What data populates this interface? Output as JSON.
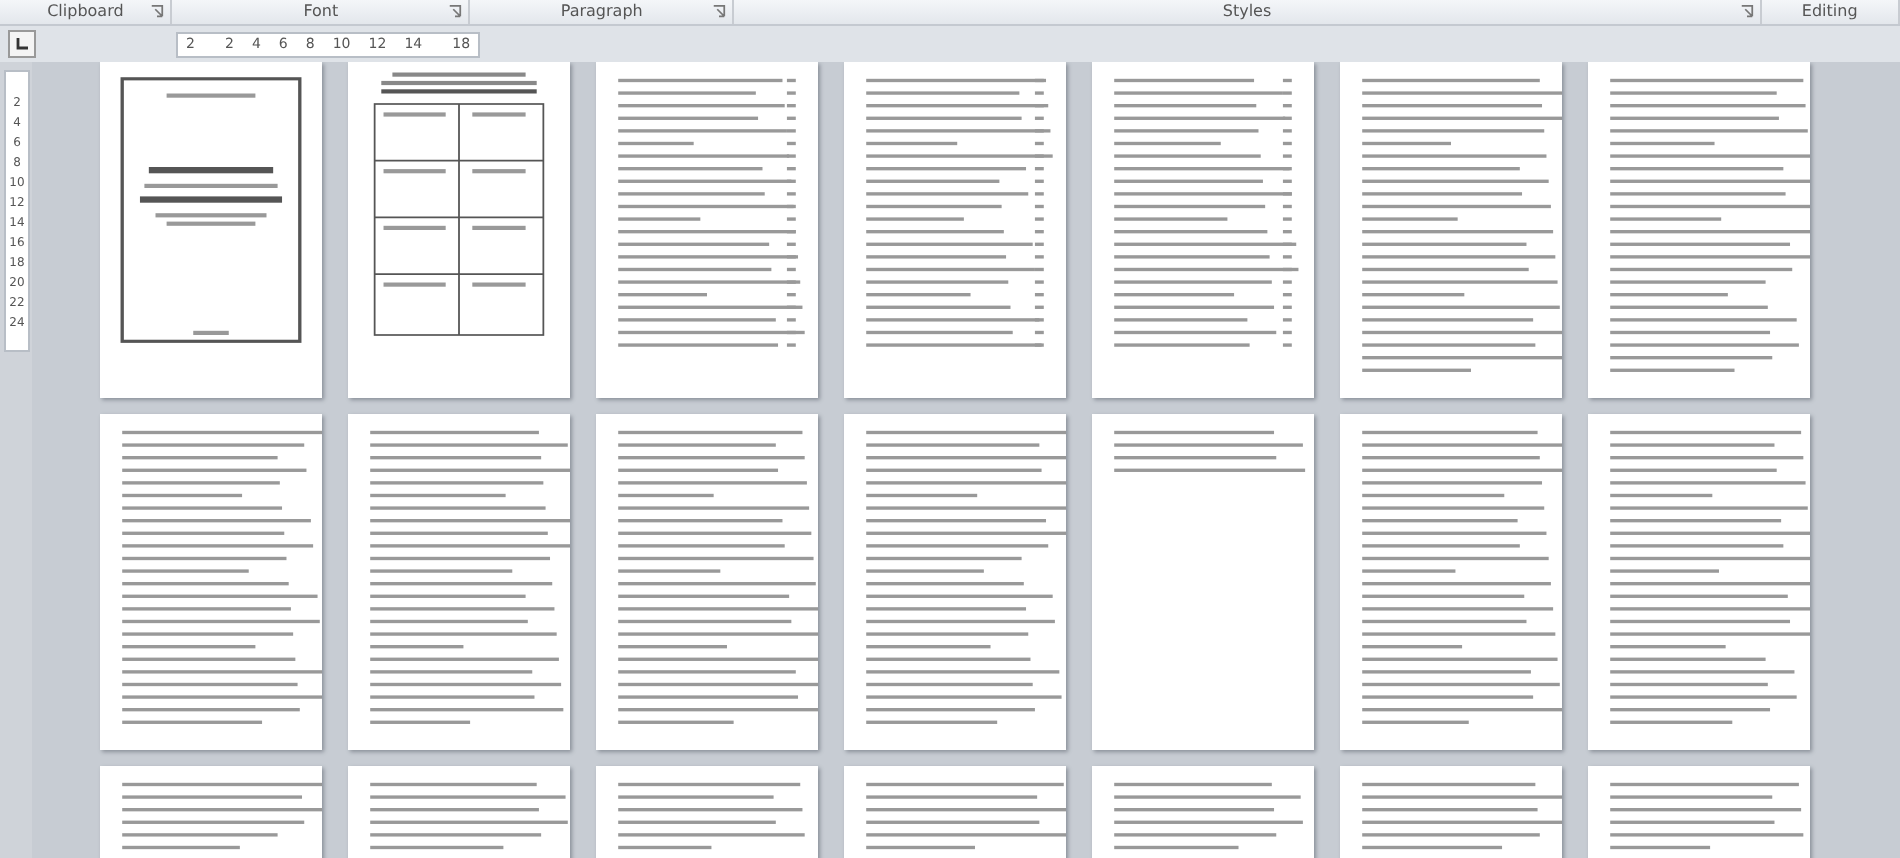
{
  "ribbon_groups": [
    {
      "label": "Clipboard",
      "launcher": true
    },
    {
      "label": "Font",
      "launcher": true
    },
    {
      "label": "Paragraph",
      "launcher": true
    },
    {
      "label": "Styles",
      "launcher": true
    },
    {
      "label": "Editing",
      "launcher": false
    }
  ],
  "horizontal_ruler": [
    "2",
    "2",
    "4",
    "6",
    "8",
    "10",
    "12",
    "14",
    "18"
  ],
  "vertical_ruler": [
    "2",
    "4",
    "6",
    "8",
    "10",
    "12",
    "14",
    "16",
    "18",
    "20",
    "22",
    "24"
  ],
  "pages": [
    {
      "kind": "cover"
    },
    {
      "kind": "table"
    },
    {
      "kind": "toc"
    },
    {
      "kind": "toc"
    },
    {
      "kind": "toc"
    },
    {
      "kind": "text"
    },
    {
      "kind": "text"
    },
    {
      "kind": "text"
    },
    {
      "kind": "text"
    },
    {
      "kind": "text"
    },
    {
      "kind": "text"
    },
    {
      "kind": "short"
    },
    {
      "kind": "text"
    },
    {
      "kind": "text"
    },
    {
      "kind": "text"
    },
    {
      "kind": "text"
    },
    {
      "kind": "text"
    },
    {
      "kind": "text"
    },
    {
      "kind": "text"
    },
    {
      "kind": "text"
    },
    {
      "kind": "text"
    }
  ]
}
